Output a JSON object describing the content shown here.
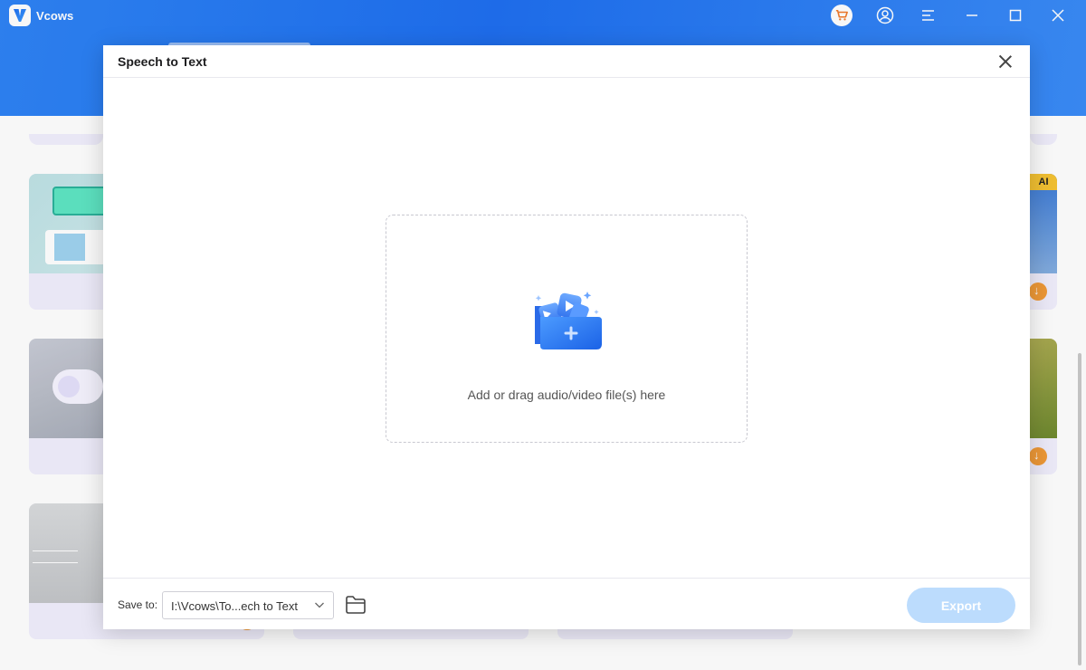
{
  "app": {
    "name": "Vcows"
  },
  "background": {
    "ai_badge": "AI"
  },
  "dialog": {
    "title": "Speech to Text",
    "dropzone_text": "Add or drag audio/video file(s) here",
    "save_to_label": "Save to:",
    "save_path": "I:\\Vcows\\To...ech to Text",
    "export_label": "Export",
    "export_enabled": false
  },
  "colors": {
    "header_blue": "#1f6ff0",
    "export_disabled": "#bcdcfd",
    "badge_orange": "#f29b38",
    "ai_badge_yellow": "#f6c433"
  }
}
